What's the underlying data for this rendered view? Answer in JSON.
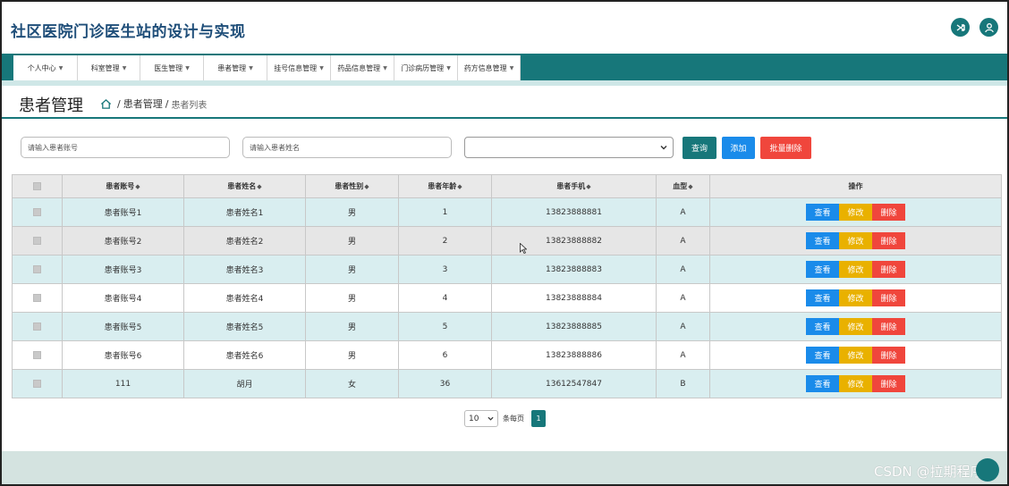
{
  "app": {
    "title": "社区医院门诊医生站的设计与实现"
  },
  "header": {
    "icons": [
      "shuffle-icon",
      "user-icon"
    ]
  },
  "nav": {
    "items": [
      {
        "label": "个人中心"
      },
      {
        "label": "科室管理"
      },
      {
        "label": "医生管理"
      },
      {
        "label": "患者管理"
      },
      {
        "label": "挂号信息管理"
      },
      {
        "label": "药品信息管理"
      },
      {
        "label": "门诊病历管理"
      },
      {
        "label": "药方信息管理"
      }
    ]
  },
  "page": {
    "title": "患者管理",
    "breadcrumb": {
      "sep": "/",
      "section": "患者管理",
      "current": "患者列表"
    }
  },
  "search": {
    "account_placeholder": "请输入患者账号",
    "name_placeholder": "请输入患者姓名",
    "select_value": "",
    "query_label": "查询",
    "add_label": "添加",
    "batch_delete_label": "批量删除"
  },
  "table": {
    "columns": [
      "患者账号",
      "患者姓名",
      "患者性别",
      "患者年龄",
      "患者手机",
      "血型",
      "操作"
    ],
    "sort_glyph": "◆",
    "rows": [
      {
        "account": "患者账号1",
        "name": "患者姓名1",
        "gender": "男",
        "age": "1",
        "phone": "13823888881",
        "blood": "A"
      },
      {
        "account": "患者账号2",
        "name": "患者姓名2",
        "gender": "男",
        "age": "2",
        "phone": "13823888882",
        "blood": "A"
      },
      {
        "account": "患者账号3",
        "name": "患者姓名3",
        "gender": "男",
        "age": "3",
        "phone": "13823888883",
        "blood": "A"
      },
      {
        "account": "患者账号4",
        "name": "患者姓名4",
        "gender": "男",
        "age": "4",
        "phone": "13823888884",
        "blood": "A"
      },
      {
        "account": "患者账号5",
        "name": "患者姓名5",
        "gender": "男",
        "age": "5",
        "phone": "13823888885",
        "blood": "A"
      },
      {
        "account": "患者账号6",
        "name": "患者姓名6",
        "gender": "男",
        "age": "6",
        "phone": "13823888886",
        "blood": "A"
      },
      {
        "account": "111",
        "name": "胡月",
        "gender": "女",
        "age": "36",
        "phone": "13612547847",
        "blood": "B"
      }
    ],
    "actions": {
      "view": "查看",
      "edit": "修改",
      "delete": "删除"
    }
  },
  "pager": {
    "page_size": "10",
    "per_page_label": "条每页",
    "current_page": "1"
  },
  "watermark": "CSDN @拉期程序",
  "colors": {
    "primary": "#17777a",
    "blue": "#1a8bea",
    "yellow": "#e9b100",
    "red": "#f0463c",
    "row_alt": "#d9eef0"
  }
}
